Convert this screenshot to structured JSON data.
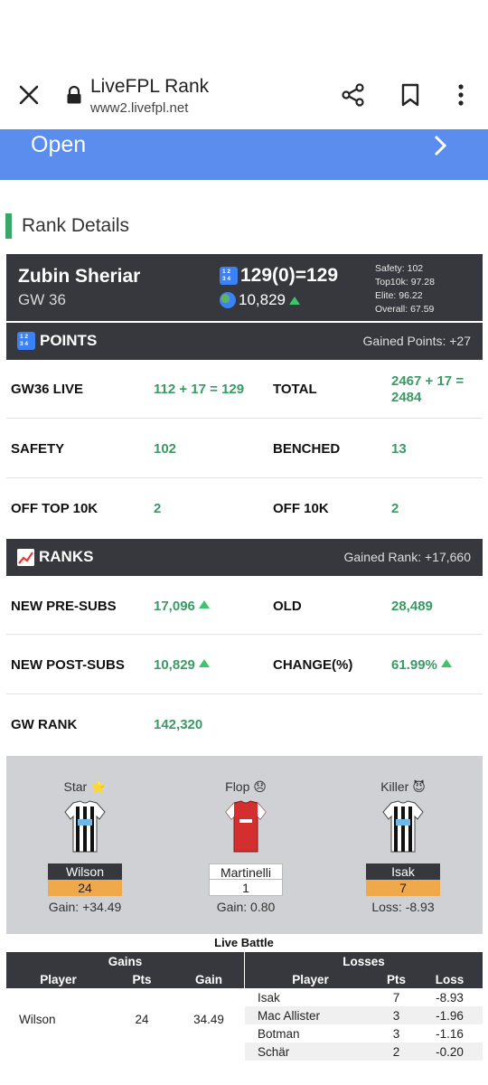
{
  "browser": {
    "title": "LiveFPL Rank",
    "url": "www2.livefpl.net"
  },
  "banner": {
    "label": "Open"
  },
  "section": {
    "title": "Rank Details"
  },
  "manager": {
    "name": "Zubin Sheriar",
    "gw": "GW 36",
    "points": "129(0)=129",
    "overall_rank": "10,829",
    "stats": [
      "Safety: 102",
      "Top10k: 97.28",
      "Elite: 96.22",
      "Overall: 67.59"
    ]
  },
  "points_band": {
    "title": "POINTS",
    "right": "Gained Points: +27"
  },
  "points_rows": [
    {
      "l1": "GW36 LIVE",
      "v1": "112 + 17 = 129",
      "l2": "TOTAL",
      "v2": "2467 + 17 = 2484"
    },
    {
      "l1": "SAFETY",
      "v1": "102",
      "l2": "BENCHED",
      "v2": "13"
    },
    {
      "l1": "OFF TOP 10K",
      "v1": "2",
      "l2": "OFF 10K",
      "v2": "2"
    }
  ],
  "ranks_band": {
    "title": "RANKS",
    "right": "Gained Rank: +17,660"
  },
  "rank_rows": [
    {
      "l1": "NEW PRE-SUBS",
      "v1": "17,096",
      "l2": "OLD",
      "v2": "28,489"
    },
    {
      "l1": "NEW POST-SUBS",
      "v1": "10,829",
      "l2": "CHANGE(%)",
      "v2": "61.99%"
    },
    {
      "l1": "GW RANK",
      "v1": "142,320",
      "l2": "",
      "v2": ""
    }
  ],
  "players": [
    {
      "tag": "Star ⭐",
      "name": "Wilson",
      "pts": "24",
      "gain": "Gain: +34.49"
    },
    {
      "tag": "Flop 😞",
      "name": "Martinelli",
      "pts": "1",
      "gain": "Gain: 0.80"
    },
    {
      "tag": "Killer 😈",
      "name": "Isak",
      "pts": "7",
      "gain": "Loss: -8.93"
    }
  ],
  "battle": {
    "title": "Live Battle",
    "gains_header": "Gains",
    "losses_header": "Losses",
    "cols": {
      "player": "Player",
      "pts": "Pts",
      "gain": "Gain",
      "loss": "Loss"
    },
    "gains": [
      {
        "player": "Wilson",
        "pts": "24",
        "gain": "34.49"
      }
    ],
    "losses": [
      {
        "player": "Isak",
        "pts": "7",
        "loss": "-8.93"
      },
      {
        "player": "Mac Allister",
        "pts": "3",
        "loss": "-1.96"
      },
      {
        "player": "Botman",
        "pts": "3",
        "loss": "-1.16"
      },
      {
        "player": "Schär",
        "pts": "2",
        "loss": "-0.20"
      }
    ]
  }
}
